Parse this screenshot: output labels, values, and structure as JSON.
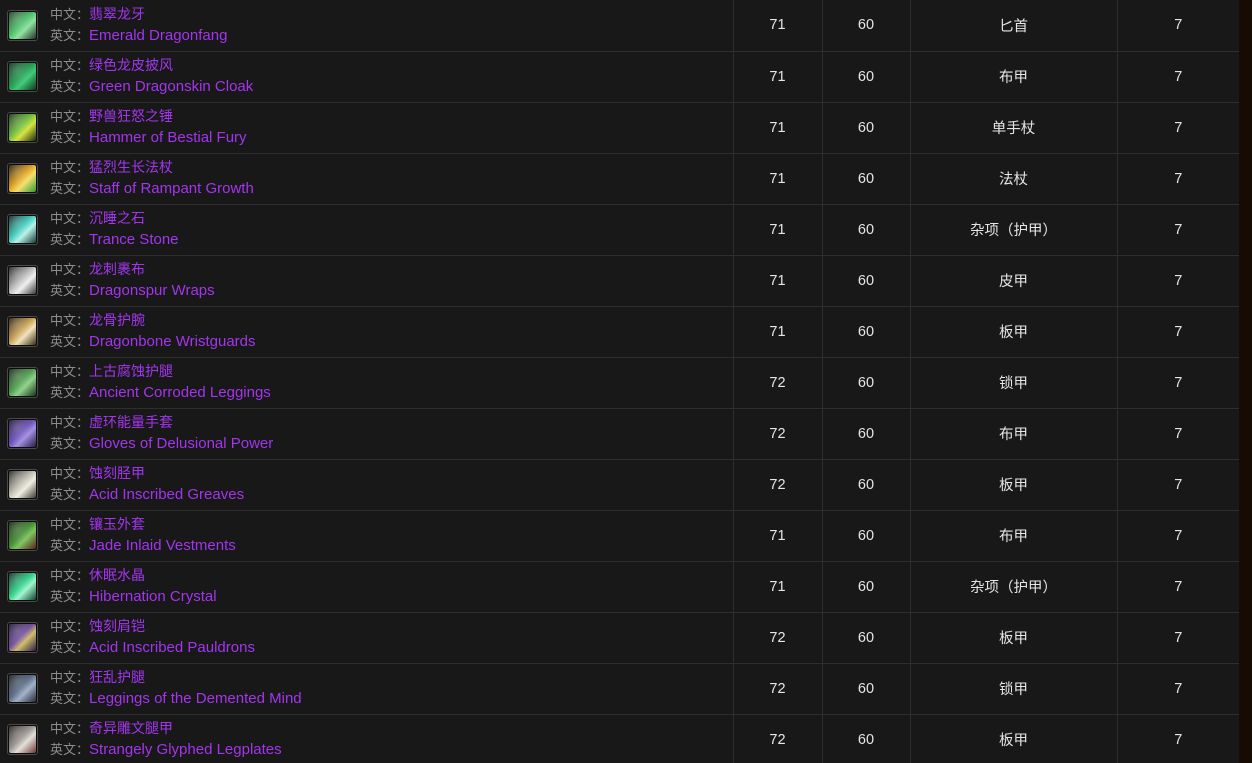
{
  "labels": {
    "chinese_prefix": "中文：",
    "english_prefix": "英文："
  },
  "table": {
    "rows": [
      {
        "icon": "sword-emerald-dragonfang-icon",
        "icon_colors": [
          "#1d3a22",
          "#49c06a",
          "#8fe2a0",
          "#243028"
        ],
        "name_cn": "翡翠龙牙",
        "name_en": "Emerald Dragonfang",
        "item_level": "71",
        "req_level": "60",
        "type": "匕首",
        "source": "7"
      },
      {
        "icon": "cloak-green-dragonskin-icon",
        "icon_colors": [
          "#0d2a14",
          "#1f9a4e",
          "#3ec977",
          "#10361c"
        ],
        "name_cn": "绿色龙皮披风",
        "name_en": "Green Dragonskin Cloak",
        "item_level": "71",
        "req_level": "60",
        "type": "布甲",
        "source": "7"
      },
      {
        "icon": "mace-hammer-bestial-fury-icon",
        "icon_colors": [
          "#13300f",
          "#6fbf3a",
          "#d8e23c",
          "#1b2a12"
        ],
        "name_cn": "野兽狂怒之锤",
        "name_en": "Hammer of Bestial Fury",
        "item_level": "71",
        "req_level": "60",
        "type": "单手杖",
        "source": "7"
      },
      {
        "icon": "staff-rampant-growth-icon",
        "icon_colors": [
          "#221403",
          "#e0a21c",
          "#f4e06a",
          "#2f9a3a"
        ],
        "name_cn": "猛烈生长法杖",
        "name_en": "Staff of Rampant Growth",
        "item_level": "71",
        "req_level": "60",
        "type": "法杖",
        "source": "7"
      },
      {
        "icon": "trance-stone-orb-icon",
        "icon_colors": [
          "#0b2422",
          "#3fcdc0",
          "#b6f2ea",
          "#1a3a35"
        ],
        "name_cn": "沉睡之石",
        "name_en": "Trance Stone",
        "item_level": "71",
        "req_level": "60",
        "type": "杂项（护甲）",
        "source": "7"
      },
      {
        "icon": "wraps-dragonspur-icon",
        "icon_colors": [
          "#1d1d1d",
          "#b9b9b9",
          "#efefef",
          "#3a3a3a"
        ],
        "name_cn": "龙刺裹布",
        "name_en": "Dragonspur Wraps",
        "item_level": "71",
        "req_level": "60",
        "type": "皮甲",
        "source": "7"
      },
      {
        "icon": "wristguards-dragonbone-icon",
        "icon_colors": [
          "#231a0b",
          "#c9a050",
          "#f0e2bd",
          "#3a2c12"
        ],
        "name_cn": "龙骨护腕",
        "name_en": "Dragonbone Wristguards",
        "item_level": "71",
        "req_level": "60",
        "type": "板甲",
        "source": "7"
      },
      {
        "icon": "leggings-ancient-corroded-icon",
        "icon_colors": [
          "#0f2410",
          "#4c9c4c",
          "#8fd08a",
          "#17331a"
        ],
        "name_cn": "上古腐蚀护腿",
        "name_en": "Ancient Corroded Leggings",
        "item_level": "72",
        "req_level": "60",
        "type": "锁甲",
        "source": "7"
      },
      {
        "icon": "gloves-delusional-power-icon",
        "icon_colors": [
          "#1b1030",
          "#6a4fb8",
          "#a18fe0",
          "#271a44"
        ],
        "name_cn": "虚环能量手套",
        "name_en": "Gloves of Delusional Power",
        "item_level": "72",
        "req_level": "60",
        "type": "布甲",
        "source": "7"
      },
      {
        "icon": "greaves-acid-inscribed-icon",
        "icon_colors": [
          "#20201c",
          "#c0bcb0",
          "#efece0",
          "#3b3a33"
        ],
        "name_cn": "蚀刻胫甲",
        "name_en": "Acid Inscribed Greaves",
        "item_level": "72",
        "req_level": "60",
        "type": "板甲",
        "source": "7"
      },
      {
        "icon": "vestments-jade-inlaid-icon",
        "icon_colors": [
          "#14210f",
          "#3f8a2f",
          "#7fc45f",
          "#5a2020"
        ],
        "name_cn": "镶玉外套",
        "name_en": "Jade Inlaid Vestments",
        "item_level": "71",
        "req_level": "60",
        "type": "布甲",
        "source": "7"
      },
      {
        "icon": "hibernation-crystal-icon",
        "icon_colors": [
          "#0a2a1c",
          "#28cf86",
          "#9ff5cf",
          "#13402c"
        ],
        "name_cn": "休眠水晶",
        "name_en": "Hibernation Crystal",
        "item_level": "71",
        "req_level": "60",
        "type": "杂项（护甲）",
        "source": "7"
      },
      {
        "icon": "pauldrons-acid-inscribed-icon",
        "icon_colors": [
          "#1c1230",
          "#6f4f9e",
          "#d0bb6a",
          "#2a1c44"
        ],
        "name_cn": "蚀刻肩铠",
        "name_en": "Acid Inscribed Pauldrons",
        "item_level": "72",
        "req_level": "60",
        "type": "板甲",
        "source": "7"
      },
      {
        "icon": "leggings-demented-mind-icon",
        "icon_colors": [
          "#15181f",
          "#5a6b84",
          "#9fb0c8",
          "#252b36"
        ],
        "name_cn": "狂乱护腿",
        "name_en": "Leggings of the Demented Mind",
        "item_level": "72",
        "req_level": "60",
        "type": "锁甲",
        "source": "7"
      },
      {
        "icon": "legplates-strangely-glyphed-icon",
        "icon_colors": [
          "#1e1a18",
          "#9a9490",
          "#e2ded8",
          "#6b3a33"
        ],
        "name_cn": "奇异雕文腿甲",
        "name_en": "Strangely Glyphed Legplates",
        "item_level": "72",
        "req_level": "60",
        "type": "板甲",
        "source": "7"
      }
    ]
  }
}
